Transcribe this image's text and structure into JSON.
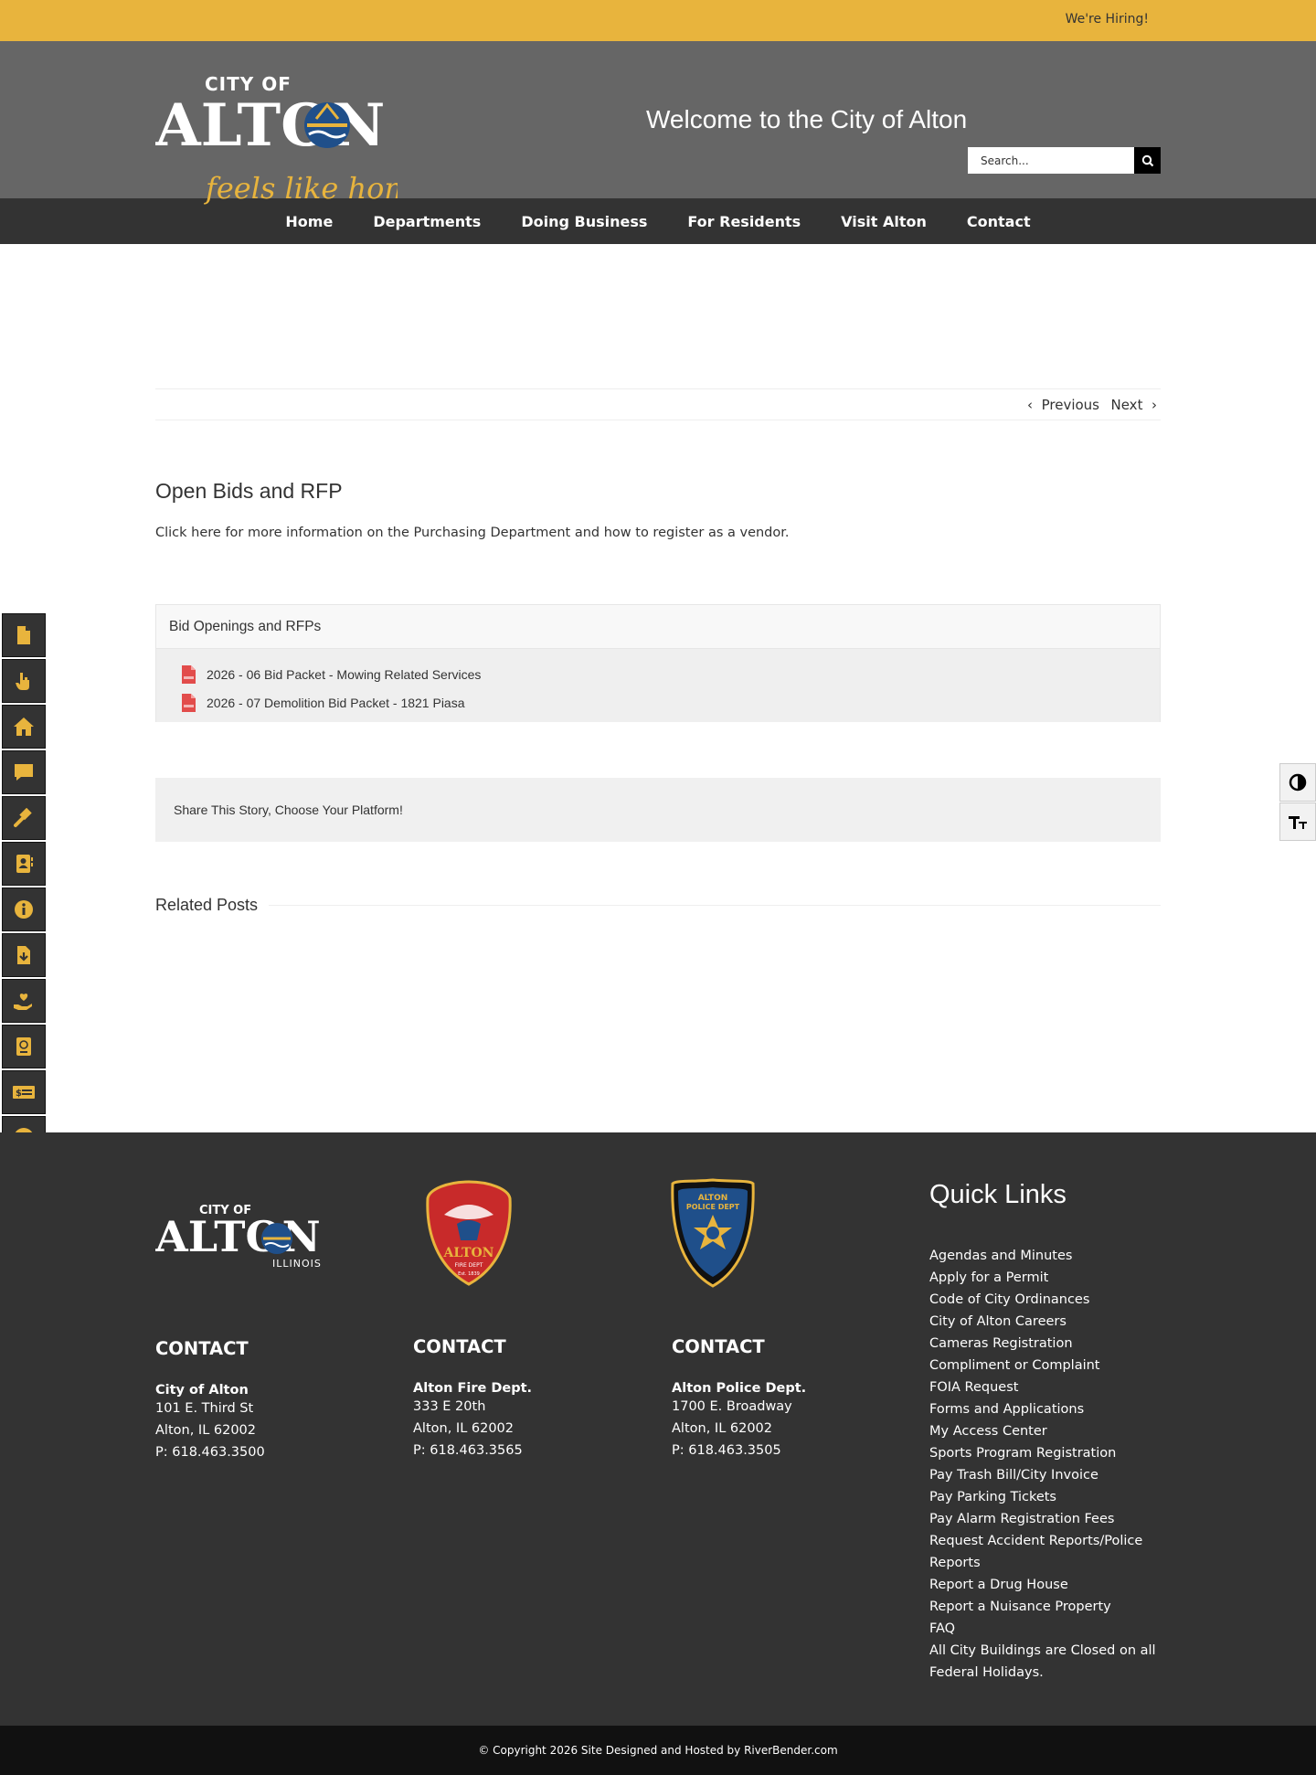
{
  "topbar": {
    "hiring": "We're Hiring!"
  },
  "header": {
    "logo_top": "CITY OF",
    "logo_main": "ALTON",
    "logo_tagline": "feels like home",
    "welcome": "Welcome to the City of Alton",
    "search_placeholder": "Search..."
  },
  "nav": {
    "items": [
      "Home",
      "Departments",
      "Doing Business",
      "For Residents",
      "Visit Alton",
      "Contact"
    ]
  },
  "post_nav": {
    "previous": "Previous",
    "next": "Next"
  },
  "article": {
    "title": "Open Bids and RFP",
    "intro": "Click here for more information on the Purchasing Department and how to register as a vendor.",
    "bids_header": "Bid Openings and RFPs",
    "bids": [
      "2026 - 06 Bid Packet - Mowing Related Services",
      "2026 - 07 Demolition Bid Packet - 1821 Piasa"
    ],
    "share": "Share This Story, Choose Your Platform!",
    "related": "Related Posts"
  },
  "sidebar_icons": [
    "document-icon",
    "hand-icon",
    "home-icon",
    "comment-icon",
    "gavel-icon",
    "contact-book-icon",
    "info-icon",
    "download-file-icon",
    "heart-hand-icon",
    "passport-icon",
    "money-icon",
    "soccer-ball-icon"
  ],
  "tools": {
    "contrast": "contrast-icon",
    "text_size": "text-size-icon"
  },
  "footer": {
    "logo_top": "CITY OF",
    "logo_main": "ALTON",
    "logo_sub": "ILLINOIS",
    "fire_badge_top": "ALTON",
    "fire_badge_sub": "FIRE DEPT",
    "fire_badge_est": "Est. 1839",
    "police_badge_top": "ALTON",
    "police_badge_sub": "POLICE DEPT",
    "contacts": [
      {
        "heading": "CONTACT",
        "name": "City of Alton",
        "line1": "101 E. Third St",
        "line2": "Alton, IL 62002",
        "phone": "P: 618.463.3500"
      },
      {
        "heading": "CONTACT",
        "name": "Alton Fire Dept.",
        "line1": "333 E 20th",
        "line2": "Alton, IL 62002",
        "phone": "P: 618.463.3565"
      },
      {
        "heading": "CONTACT",
        "name": "Alton Police Dept.",
        "line1": "1700 E. Broadway",
        "line2": "Alton, IL 62002",
        "phone": "P: 618.463.3505"
      }
    ],
    "quick_links_title": "Quick Links",
    "quick_links": [
      "Agendas and Minutes",
      "Apply for a Permit",
      "Code of City Ordinances",
      "City of Alton Careers",
      "Cameras Registration",
      "Compliment or Complaint",
      "FOIA Request",
      "Forms and Applications",
      "My Access Center",
      "Sports Program Registration",
      "Pay Trash Bill/City Invoice",
      "Pay Parking Tickets",
      "Pay Alarm Registration Fees",
      "Request Accident Reports/Police Reports",
      "Report a Drug House",
      "Report a Nuisance Property",
      "FAQ"
    ],
    "holiday_note": "All City Buildings are Closed on all Federal Holidays.",
    "copyright": "© Copyright 2026 Site Designed and Hosted by RiverBender.com"
  },
  "colors": {
    "gold": "#e8b43d",
    "header_gray": "#666666",
    "nav_dark": "#333333",
    "footer_dark": "#333333",
    "copyright_bar": "#111111",
    "pdf_red": "#e24c4b",
    "logo_blue": "#1f4f8a"
  }
}
